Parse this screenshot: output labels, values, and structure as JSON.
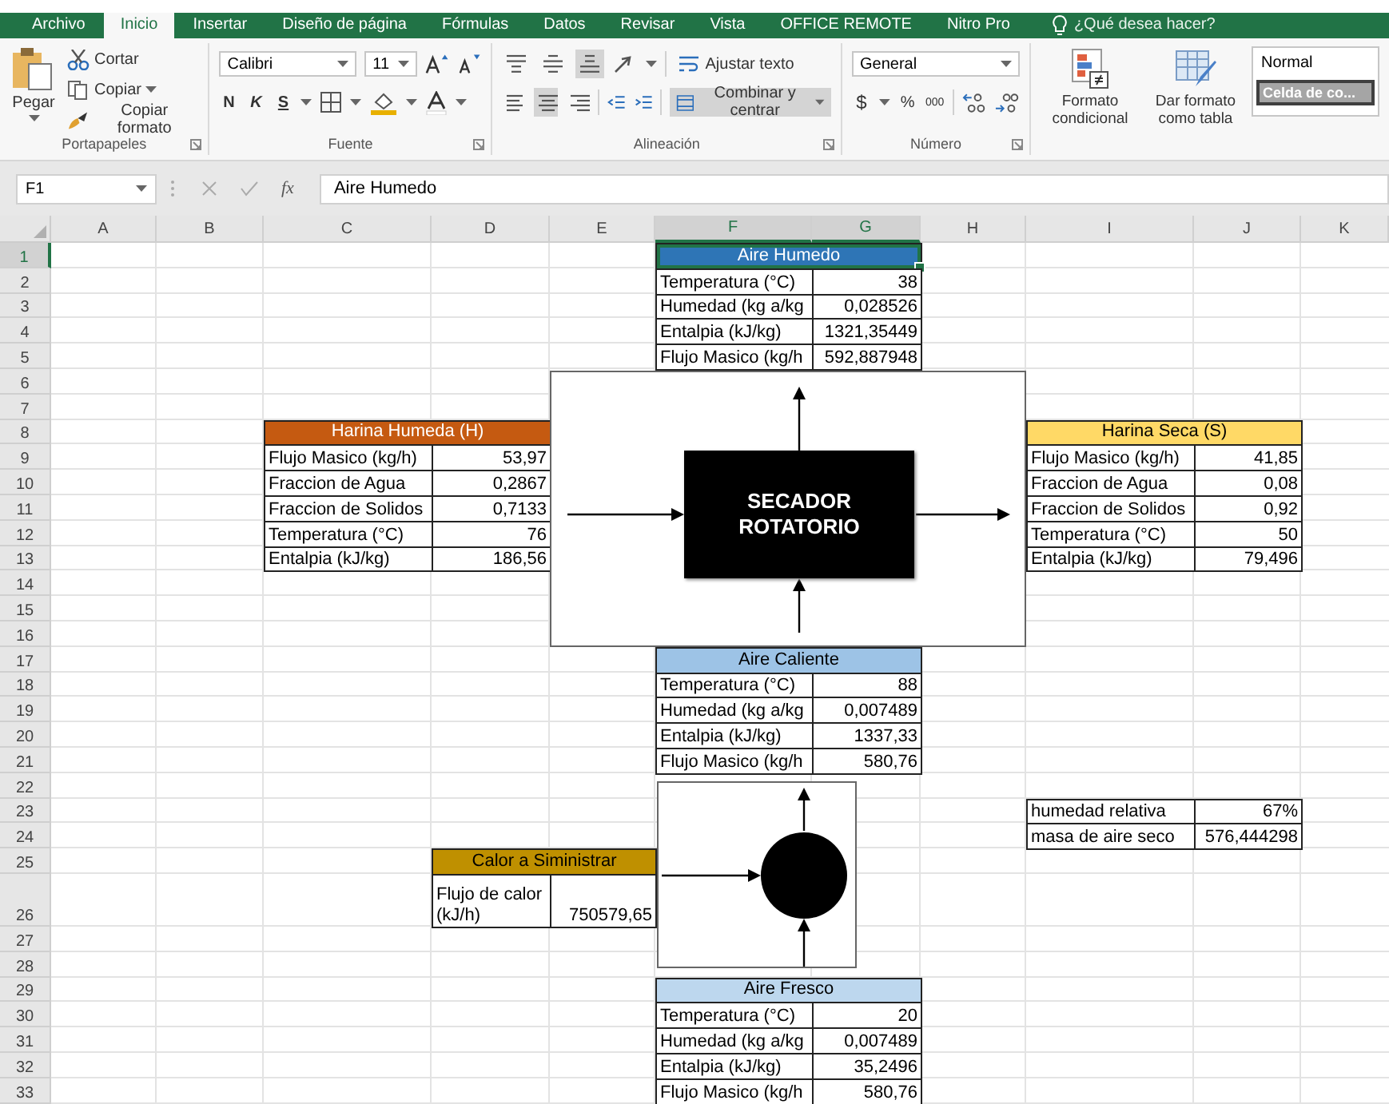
{
  "menu_tabs": [
    {
      "label": "Archivo",
      "selected": false
    },
    {
      "label": "Inicio",
      "selected": true
    },
    {
      "label": "Insertar",
      "selected": false
    },
    {
      "label": "Diseño de página",
      "selected": false
    },
    {
      "label": "Fórmulas",
      "selected": false
    },
    {
      "label": "Datos",
      "selected": false
    },
    {
      "label": "Revisar",
      "selected": false
    },
    {
      "label": "Vista",
      "selected": false
    },
    {
      "label": "OFFICE REMOTE",
      "selected": false
    },
    {
      "label": "Nitro Pro",
      "selected": false
    }
  ],
  "tell_me": "¿Qué desea hacer?",
  "ribbon": {
    "clipboard": {
      "paste": "Pegar",
      "cut": "Cortar",
      "copy": "Copiar",
      "format_painter": "Copiar formato",
      "group": "Portapapeles"
    },
    "font": {
      "name": "Calibri",
      "size": "11",
      "bold": "N",
      "italic": "K",
      "underline": "S",
      "group": "Fuente"
    },
    "alignment": {
      "vertical": [
        {
          "kind": "top",
          "selected": false
        },
        {
          "kind": "middle",
          "selected": false
        },
        {
          "kind": "bottom",
          "selected": true
        }
      ],
      "horizontal": [
        {
          "kind": "left",
          "selected": false
        },
        {
          "kind": "center",
          "selected": true
        },
        {
          "kind": "right",
          "selected": false
        }
      ],
      "wrap": "Ajustar texto",
      "merge": {
        "label": "Combinar y centrar",
        "selected": true
      },
      "group": "Alineación"
    },
    "number": {
      "format": "General",
      "currency": "$",
      "percent": "%",
      "thousands": "000",
      "group": "Número"
    },
    "styles": {
      "conditional": "Formato condicional",
      "table": "Dar formato como tabla",
      "normal": "Normal",
      "check_cell": "Celda de co..."
    }
  },
  "formula_bar": {
    "name_box": "F1",
    "function_symbol": "fx",
    "content": "Aire Humedo"
  },
  "columns": [
    {
      "label": "A",
      "selected": false
    },
    {
      "label": "B",
      "selected": false
    },
    {
      "label": "C",
      "selected": false
    },
    {
      "label": "D",
      "selected": false
    },
    {
      "label": "E",
      "selected": false
    },
    {
      "label": "F",
      "selected": true
    },
    {
      "label": "G",
      "selected": true
    },
    {
      "label": "H",
      "selected": false
    },
    {
      "label": "I",
      "selected": false
    },
    {
      "label": "J",
      "selected": false
    },
    {
      "label": "K",
      "selected": false
    }
  ],
  "rows": [
    {
      "label": "1",
      "selected": true
    },
    {
      "label": "2",
      "selected": false
    },
    {
      "label": "3",
      "selected": false
    },
    {
      "label": "4",
      "selected": false
    },
    {
      "label": "5",
      "selected": false
    },
    {
      "label": "6",
      "selected": false
    },
    {
      "label": "7",
      "selected": false
    },
    {
      "label": "8",
      "selected": false
    },
    {
      "label": "9",
      "selected": false
    },
    {
      "label": "10",
      "selected": false
    },
    {
      "label": "11",
      "selected": false
    },
    {
      "label": "12",
      "selected": false
    },
    {
      "label": "13",
      "selected": false
    },
    {
      "label": "14",
      "selected": false
    },
    {
      "label": "15",
      "selected": false
    },
    {
      "label": "16",
      "selected": false
    },
    {
      "label": "17",
      "selected": false
    },
    {
      "label": "18",
      "selected": false
    },
    {
      "label": "19",
      "selected": false
    },
    {
      "label": "20",
      "selected": false
    },
    {
      "label": "21",
      "selected": false
    },
    {
      "label": "22",
      "selected": false
    },
    {
      "label": "23",
      "selected": false
    },
    {
      "label": "24",
      "selected": false
    },
    {
      "label": "25",
      "selected": false
    },
    {
      "label": "26",
      "selected": false
    },
    {
      "label": "27",
      "selected": false
    },
    {
      "label": "28",
      "selected": false
    },
    {
      "label": "29",
      "selected": false
    },
    {
      "label": "30",
      "selected": false
    },
    {
      "label": "31",
      "selected": false
    },
    {
      "label": "32",
      "selected": false
    },
    {
      "label": "33",
      "selected": false
    }
  ],
  "tables": [
    {
      "title": "Aire Humedo",
      "color": "#2e75b6",
      "selected": true,
      "rows": [
        {
          "label": "Temperatura (°C)",
          "value": "38"
        },
        {
          "label": "Humedad (kg a/kg",
          "value": "0,028526"
        },
        {
          "label": "Entalpia (kJ/kg)",
          "value": "1321,35449"
        },
        {
          "label": "Flujo Masico (kg/h",
          "value": "592,887948"
        }
      ]
    },
    {
      "title": "Harina Humeda (H)",
      "color": "#c55a11",
      "selected": false,
      "rows": [
        {
          "label": "Flujo Masico (kg/h)",
          "value": "53,97"
        },
        {
          "label": "Fraccion de Agua",
          "value": "0,2867"
        },
        {
          "label": "Fraccion de Solidos",
          "value": "0,7133"
        },
        {
          "label": "Temperatura (°C)",
          "value": "76"
        },
        {
          "label": "Entalpia (kJ/kg)",
          "value": "186,56"
        }
      ]
    },
    {
      "title": "Harina Seca (S)",
      "color": "#ffd966",
      "selected": false,
      "rows": [
        {
          "label": "Flujo Masico (kg/h)",
          "value": "41,85"
        },
        {
          "label": "Fraccion de Agua",
          "value": "0,08"
        },
        {
          "label": "Fraccion de Solidos",
          "value": "0,92"
        },
        {
          "label": "Temperatura (°C)",
          "value": "50"
        },
        {
          "label": "Entalpia (kJ/kg)",
          "value": "79,496"
        }
      ]
    },
    {
      "title": "Aire Caliente",
      "color": "#9dc3e6",
      "selected": false,
      "rows": [
        {
          "label": "Temperatura (°C)",
          "value": "88"
        },
        {
          "label": "Humedad (kg a/kg",
          "value": "0,007489"
        },
        {
          "label": "Entalpia (kJ/kg)",
          "value": "1337,33"
        },
        {
          "label": "Flujo Masico (kg/h",
          "value": "580,76"
        }
      ]
    },
    {
      "selected": false,
      "rows": [
        {
          "label": "humedad relativa",
          "value": "67%"
        },
        {
          "label": "masa de aire seco",
          "value": "576,444298"
        }
      ]
    },
    {
      "title": "Calor a Siministrar",
      "color": "#bf9000",
      "selected": false,
      "rows": [
        {
          "label": "Flujo de calor (kJ/h)",
          "value": "750579,65"
        }
      ]
    },
    {
      "title": "Aire Fresco",
      "color": "#bdd7ee",
      "selected": false,
      "rows": [
        {
          "label": "Temperatura (°C)",
          "value": "20"
        },
        {
          "label": "Humedad (kg a/kg",
          "value": "0,007489"
        },
        {
          "label": "Entalpia (kJ/kg)",
          "value": "35,2496"
        },
        {
          "label": "Flujo Masico (kg/h",
          "value": "580,76"
        }
      ]
    }
  ],
  "diagram": {
    "dryer_label": "SECADOR ROTATORIO"
  }
}
